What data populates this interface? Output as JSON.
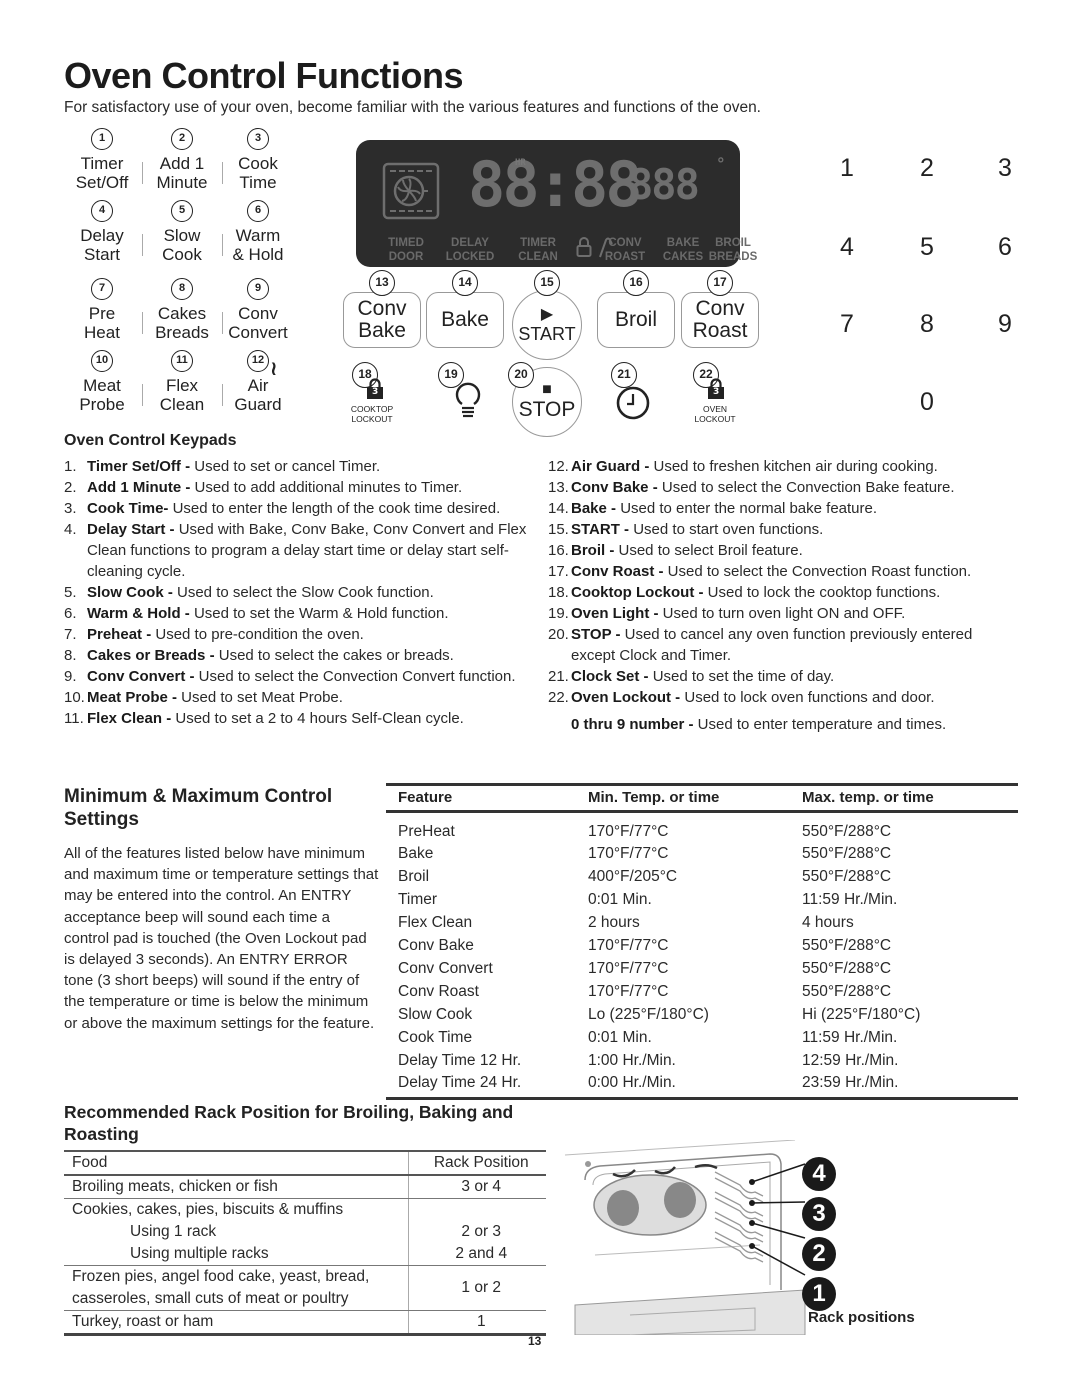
{
  "page": {
    "title": "Oven Control Functions",
    "intro": "For satisfactory use of your oven, become familiar with the various features and functions of the oven.",
    "page_number": "13"
  },
  "keys": [
    {
      "num": "1",
      "line1": "Timer",
      "line2": "Set/Off"
    },
    {
      "num": "2",
      "line1": "Add 1",
      "line2": "Minute"
    },
    {
      "num": "3",
      "line1": "Cook",
      "line2": "Time"
    },
    {
      "num": "4",
      "line1": "Delay",
      "line2": "Start"
    },
    {
      "num": "5",
      "line1": "Slow",
      "line2": "Cook"
    },
    {
      "num": "6",
      "line1": "Warm",
      "line2": "& Hold"
    },
    {
      "num": "7",
      "line1": "Pre",
      "line2": "Heat"
    },
    {
      "num": "8",
      "line1": "Cakes",
      "line2": "Breads"
    },
    {
      "num": "9",
      "line1": "Conv",
      "line2": "Convert"
    },
    {
      "num": "10",
      "line1": "Meat",
      "line2": "Probe"
    },
    {
      "num": "11",
      "line1": "Flex",
      "line2": "Clean"
    },
    {
      "num": "12",
      "line1": "Air",
      "line2": "Guard"
    }
  ],
  "lcd": {
    "clock": "88:88",
    "hr": "HR",
    "temp": "888",
    "degree": "°",
    "words_left": [
      [
        "TIMED",
        "DOOR"
      ],
      [
        "DELAY",
        "LOCKED"
      ],
      [
        "TIMER",
        "CLEAN"
      ]
    ],
    "words_right": [
      [
        "CONV",
        "ROAST"
      ],
      [
        "BAKE",
        "CAKES"
      ],
      [
        "BROIL",
        "BREADS"
      ]
    ]
  },
  "pads": [
    {
      "num": "13",
      "line1": "Conv",
      "line2": "Bake"
    },
    {
      "num": "14",
      "line1": "Bake",
      "line2": ""
    },
    {
      "num": "15",
      "line1": "▶",
      "line2": "START"
    },
    {
      "num": "16",
      "line1": "Broil",
      "line2": ""
    },
    {
      "num": "17",
      "line1": "Conv",
      "line2": "Roast"
    },
    {
      "num": "18",
      "icon_text": "3",
      "caption1": "COOKTOP",
      "caption2": "LOCKOUT"
    },
    {
      "num": "19"
    },
    {
      "num": "20",
      "line1": "■",
      "line2": "STOP"
    },
    {
      "num": "21"
    },
    {
      "num": "22",
      "icon_text": "3",
      "caption1": "OVEN",
      "caption2": "LOCKOUT"
    }
  ],
  "numpad": [
    "1",
    "2",
    "3",
    "4",
    "5",
    "6",
    "7",
    "8",
    "9",
    "0"
  ],
  "keypads_section": {
    "heading": "Oven Control Keypads",
    "left_items": [
      {
        "n": "1.",
        "term": "Timer Set/Off -",
        "desc": " Used to set or cancel Timer."
      },
      {
        "n": "2.",
        "term": "Add 1 Minute -",
        "desc": " Used to add additional minutes to Timer."
      },
      {
        "n": "3.",
        "term": "Cook Time-",
        "desc": " Used to enter the length of the cook time desired."
      },
      {
        "n": "4.",
        "term": "Delay Start -",
        "desc": " Used with Bake, Conv Bake, Conv Convert and Flex Clean functions to program a delay start time or delay start self-cleaning cycle."
      },
      {
        "n": "5.",
        "term": "Slow Cook -",
        "desc": " Used to select the Slow Cook function."
      },
      {
        "n": "6.",
        "term": "Warm & Hold -",
        "desc": " Used to set the Warm & Hold function."
      },
      {
        "n": "7.",
        "term": "Preheat -",
        "desc": " Used to pre-condition the oven."
      },
      {
        "n": "8.",
        "term": "Cakes or Breads -",
        "desc": " Used to select the cakes or breads."
      },
      {
        "n": "9.",
        "term": "Conv Convert -",
        "desc": " Used to select the Convection Convert function."
      },
      {
        "n": "10.",
        "term": "Meat Probe -",
        "desc": " Used to set Meat Probe."
      },
      {
        "n": "11.",
        "term": "Flex Clean -",
        "desc": " Used to set a 2 to 4 hours Self-Clean cycle."
      }
    ],
    "right_items": [
      {
        "n": "12.",
        "term": "Air Guard -",
        "desc": " Used to freshen kitchen air during cooking."
      },
      {
        "n": "13.",
        "term": "Conv Bake -",
        "desc": " Used to select the Convection Bake feature."
      },
      {
        "n": "14.",
        "term": "Bake -",
        "desc": " Used to enter the normal bake feature."
      },
      {
        "n": "15.",
        "term": "START -",
        "desc": " Used to start oven functions."
      },
      {
        "n": "16.",
        "term": "Broil -",
        "desc": " Used to select Broil feature."
      },
      {
        "n": "17.",
        "term": "Conv Roast -",
        "desc": " Used to select the Convection Roast function."
      },
      {
        "n": "18.",
        "term": "Cooktop Lockout -",
        "desc": " Used to lock the cooktop functions."
      },
      {
        "n": "19.",
        "term": "Oven Light -",
        "desc": " Used to turn oven light ON and OFF."
      },
      {
        "n": "20.",
        "term": "STOP -",
        "desc": " Used to cancel any oven function previously entered except Clock and Timer."
      },
      {
        "n": "21.",
        "term": "Clock Set -",
        "desc": " Used to set the time of day."
      },
      {
        "n": "22.",
        "term": "Oven Lockout -",
        "desc": " Used to lock oven functions and door."
      }
    ],
    "numbers_note": {
      "term": "0 thru 9 number -",
      "desc": " Used to enter temperature and times."
    }
  },
  "minmax": {
    "heading": "Minimum & Maximum Control Settings",
    "paragraph": "All of the features listed below have minimum and maximum time or temperature settings that may be entered into the control. An ENTRY acceptance beep will sound each time a control pad is touched (the Oven Lockout pad is delayed 3 seconds). An ENTRY ERROR tone (3 short beeps) will sound if the entry of the temperature or time is below the minimum or above the maximum settings for the feature.",
    "columns": [
      "Feature",
      "Min. Temp. or time",
      "Max. temp. or time"
    ],
    "rows": [
      [
        "PreHeat",
        "170°F/77°C",
        "550°F/288°C"
      ],
      [
        "Bake",
        "170°F/77°C",
        "550°F/288°C"
      ],
      [
        "Broil",
        "400°F/205°C",
        "550°F/288°C"
      ],
      [
        "Timer",
        "0:01 Min.",
        "11:59 Hr./Min."
      ],
      [
        "Flex Clean",
        "2 hours",
        "4 hours"
      ],
      [
        "Conv Bake",
        "170°F/77°C",
        "550°F/288°C"
      ],
      [
        "Conv Convert",
        "170°F/77°C",
        "550°F/288°C"
      ],
      [
        "Conv Roast",
        "170°F/77°C",
        "550°F/288°C"
      ],
      [
        "Slow Cook",
        "Lo (225°F/180°C)",
        "Hi (225°F/180°C)"
      ],
      [
        "Cook Time",
        "0:01 Min.",
        "11:59 Hr./Min."
      ],
      [
        "Delay Time 12 Hr.",
        "1:00 Hr./Min.",
        "12:59 Hr./Min."
      ],
      [
        "Delay Time 24 Hr.",
        "0:00 Hr./Min.",
        "23:59 Hr./Min."
      ]
    ]
  },
  "rack": {
    "heading": "Recommended Rack Position for Broiling, Baking and Roasting",
    "columns": [
      "Food",
      "Rack Position"
    ],
    "rows": {
      "r1": [
        "Broiling meats, chicken or fish",
        "3 or 4"
      ],
      "r2_head": "Cookies, cakes, pies, biscuits & muffins",
      "r2a": [
        "Using 1 rack",
        "2 or 3"
      ],
      "r2b": [
        "Using multiple racks",
        "2 and 4"
      ],
      "r3a": "Frozen pies, angel food cake, yeast, bread,",
      "r3b": "casseroles, small cuts of meat or poultry",
      "r3_pos": "1 or 2",
      "r4": [
        "Turkey, roast or ham",
        "1"
      ]
    },
    "figure_caption": "Rack positions",
    "badges": [
      "4",
      "3",
      "2",
      "1"
    ]
  }
}
